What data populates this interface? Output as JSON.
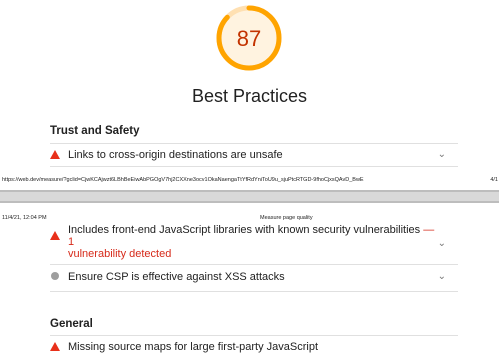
{
  "score": {
    "value": "87",
    "title": "Best Practices",
    "ring_color": "#ffa400",
    "text_color": "#c33300"
  },
  "sections": [
    {
      "title": "Trust and Safety"
    },
    {
      "title": "General"
    }
  ],
  "audits": {
    "a1": {
      "text": "Links to cross-origin destinations are unsafe",
      "status": "fail"
    },
    "a2_cut": {
      "text": "Includes front-end JavaScript libraries with known security vulnerabilities",
      "suffix": "— 1",
      "detail": "vulnerability detected",
      "status": "fail"
    },
    "a3": {
      "text": "Ensure CSP is effective against XSS attacks",
      "status": "info"
    },
    "a4": {
      "text": "Missing source maps for large first-party JavaScript",
      "status": "fail"
    }
  },
  "print": {
    "url": "https://web.dev/measure/?gclid=CjwKCAjwzt6LBhBeEiwAbPGOgV7hj2CXXne3ocv1OkaNaengaTtYfRdYniToU9u_sjuPtcRTGD-9fhoCjxsQAvD_BwE",
    "page": "4/1",
    "datetime": "11/4/21, 12:04 PM",
    "title": "Measure page quality"
  },
  "icons": {
    "fail": "warning-triangle-icon",
    "info": "gray-circle-icon",
    "expand": "chevron-down-icon"
  }
}
